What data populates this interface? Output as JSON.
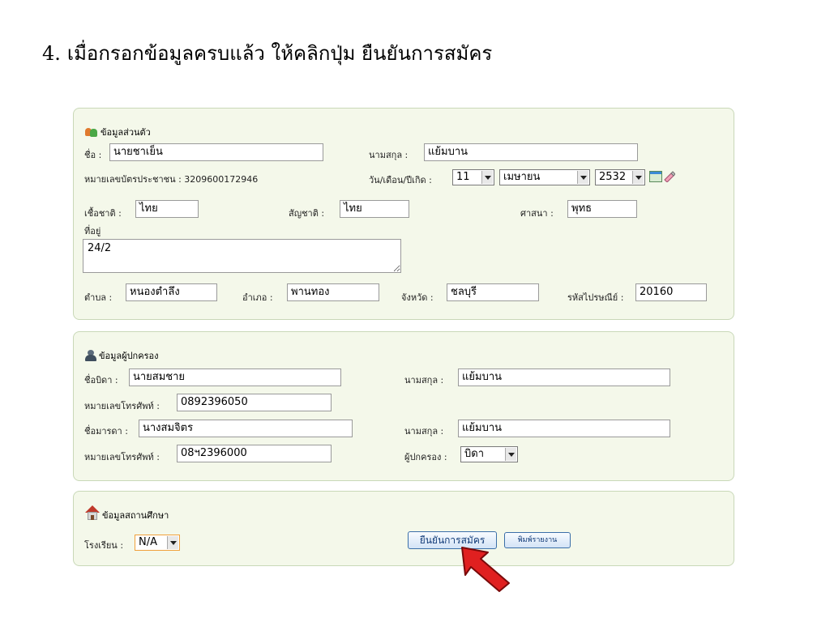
{
  "heading": {
    "number": "4.",
    "text": "เมื่อกรอกข้อมูลครบแล้ว ให้คลิกปุ่ม ยืนยันการสมัคร"
  },
  "personal": {
    "title": "ข้อมูลส่วนตัว",
    "first_name_label": "ชื่อ :",
    "first_name_value": "นายชาเย็น",
    "last_name_label": "นามสกุล :",
    "last_name_value": "แย้มบาน",
    "id_card_text": "หมายเลขบัตรประชาชน : 3209600172946",
    "dob_label": "วัน/เดือน/ปีเกิด :",
    "dob_day": "11",
    "dob_month": "เมษายน",
    "dob_year": "2532",
    "race_label": "เชื้อชาติ :",
    "race_value": "ไทย",
    "nationality_label": "สัญชาติ :",
    "nationality_value": "ไทย",
    "religion_label": "ศาสนา :",
    "religion_value": "พุทธ",
    "address_label": "ที่อยู่",
    "address_value": "24/2",
    "subdistrict_label": "ตำบล :",
    "subdistrict_value": "หนองตำลึง",
    "district_label": "อำเภอ :",
    "district_value": "พานทอง",
    "province_label": "จังหวัด :",
    "province_value": "ชลบุรี",
    "postcode_label": "รหัสไปรษณีย์ :",
    "postcode_value": "20160"
  },
  "guardian": {
    "title": "ข้อมูลผู้ปกครอง",
    "father_label": "ชื่อบิดา :",
    "father_value": "นายสมชาย",
    "father_last_label": "นามสกุล :",
    "father_last_value": "แย้มบาน",
    "father_phone_label": "หมายเลขโทรศัพท์ :",
    "father_phone_value": "0892396050",
    "mother_label": "ชื่อมารดา :",
    "mother_value": "นางสมจิตร",
    "mother_last_label": "นามสกุล :",
    "mother_last_value": "แย้มบาน",
    "mother_phone_label": "หมายเลขโทรศัพท์ :",
    "mother_phone_value": "08ฯ2396000",
    "guardian_label": "ผู้ปกครอง :",
    "guardian_value": "บิดา"
  },
  "school": {
    "title": "ข้อมูลสถานศึกษา",
    "school_label": "โรงเรียน :",
    "school_value": "N/A",
    "confirm_button": "ยืนยันการสมัคร",
    "print_button": "พิมพ์รายงาน"
  },
  "colors": {
    "panel_bg": "#f4f8ea",
    "panel_border": "#c9d8b8",
    "arrow": "#e02020",
    "button_text": "#103a78"
  }
}
